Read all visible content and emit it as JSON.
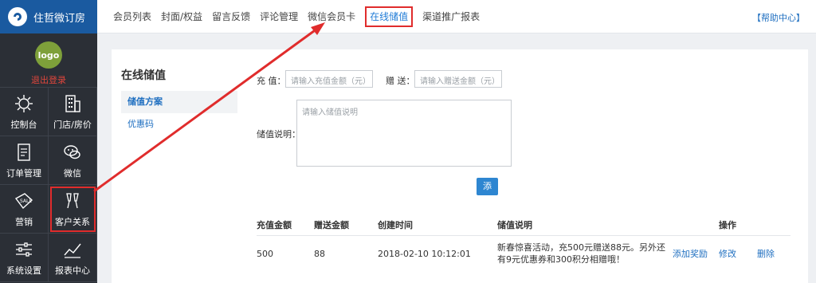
{
  "brand": {
    "title": "住哲微订房"
  },
  "profile": {
    "avatar_text": "logo",
    "logout": "退出登录"
  },
  "sidebar": {
    "items": [
      {
        "label": "控制台",
        "icon": "gear-icon"
      },
      {
        "label": "门店/房价",
        "icon": "building-icon"
      },
      {
        "label": "订单管理",
        "icon": "document-icon"
      },
      {
        "label": "微信",
        "icon": "wechat-icon"
      },
      {
        "label": "营销",
        "icon": "sale-tag-icon"
      },
      {
        "label": "客户关系",
        "icon": "cheers-icon"
      },
      {
        "label": "系统设置",
        "icon": "sliders-icon"
      },
      {
        "label": "报表中心",
        "icon": "line-chart-icon"
      }
    ]
  },
  "topnav": {
    "tabs": [
      "会员列表",
      "封面/权益",
      "留言反馈",
      "评论管理",
      "微信会员卡",
      "在线储值",
      "渠道推广报表"
    ],
    "help": "【帮助中心】"
  },
  "subnav": {
    "title": "在线储值",
    "items": [
      "储值方案",
      "优惠码"
    ]
  },
  "form": {
    "charge_label": "充  值：",
    "charge_placeholder": "请输入充值金额（元）",
    "gift_label": "赠  送：",
    "gift_placeholder": "请输入赠送金额（元）",
    "desc_label": "储值说明：",
    "desc_placeholder": "请输入储值说明",
    "add_button": "添加"
  },
  "table": {
    "headers": [
      "充值金额",
      "赠送金额",
      "创建时间",
      "储值说明",
      "操作"
    ],
    "rows": [
      {
        "amount": "500",
        "gift": "88",
        "created": "2018-02-10 10:12:01",
        "desc": "新春惊喜活动，充500元赠送88元。另外还有9元优惠券和300积分相赠哦！",
        "actions": [
          "添加奖励",
          "修改",
          "删除"
        ]
      }
    ]
  },
  "colors": {
    "brand": "#1a5aa0",
    "sidebar": "#2b2f36",
    "accent": "#1f7bd6",
    "highlight": "#e02c2c"
  }
}
